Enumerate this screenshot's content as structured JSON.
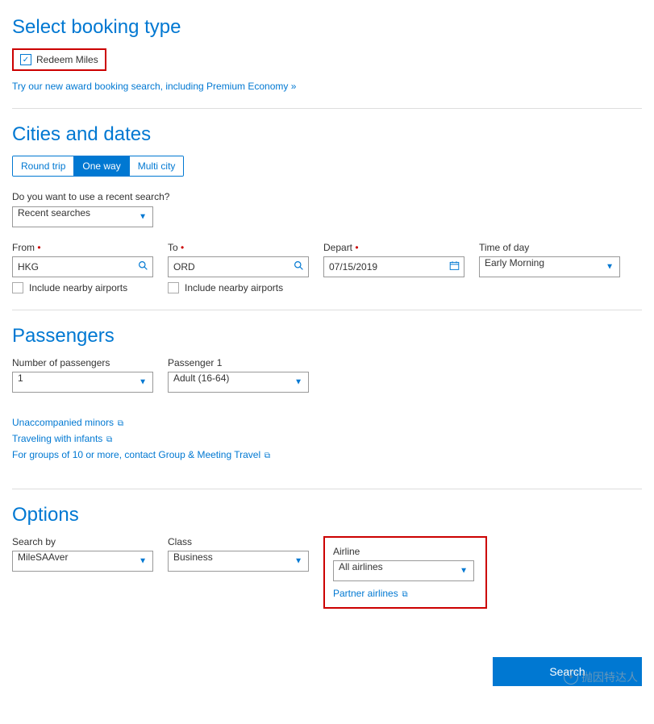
{
  "booking_type": {
    "heading": "Select booking type",
    "redeem_label": "Redeem Miles",
    "redeem_checked": true,
    "promo_link": "Try our new award booking search, including Premium Economy »"
  },
  "cities": {
    "heading": "Cities and dates",
    "trip_types": {
      "round": "Round trip",
      "oneway": "One way",
      "multi": "Multi city"
    },
    "recent_q": "Do you want to use a recent search?",
    "recent_value": "Recent searches",
    "from_label": "From",
    "from_value": "HKG",
    "to_label": "To",
    "to_value": "ORD",
    "nearby_label": "Include nearby airports",
    "depart_label": "Depart",
    "depart_value": "07/15/2019",
    "tod_label": "Time of day",
    "tod_value": "Early Morning"
  },
  "passengers": {
    "heading": "Passengers",
    "num_label": "Number of passengers",
    "num_value": "1",
    "p1_label": "Passenger 1",
    "p1_value": "Adult (16-64)",
    "link_minors": "Unaccompanied minors",
    "link_infants": "Traveling with infants",
    "link_groups": "For groups of 10 or more, contact Group & Meeting Travel"
  },
  "options": {
    "heading": "Options",
    "searchby_label": "Search by",
    "searchby_value": "MileSAAver",
    "class_label": "Class",
    "class_value": "Business",
    "airline_label": "Airline",
    "airline_value": "All airlines",
    "partner_link": "Partner airlines"
  },
  "search_button": "Search",
  "watermark": "抛因特达人"
}
